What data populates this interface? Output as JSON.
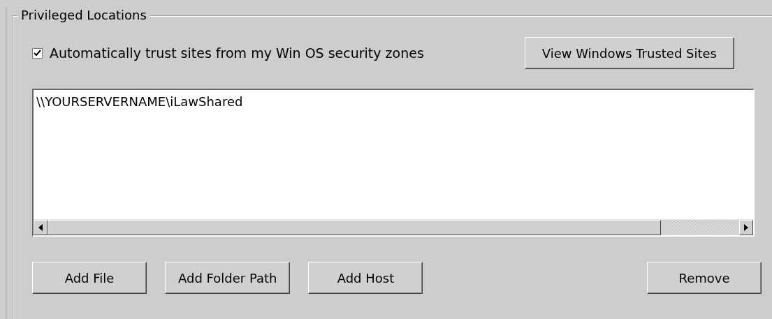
{
  "group": {
    "title": "Privileged Locations"
  },
  "auto_trust": {
    "label": "Automatically trust sites from my Win OS security zones",
    "checked": true
  },
  "view_button": "View Windows Trusted Sites",
  "locations": [
    {
      "path": "\\\\YOURSERVERNAME\\iLawShared",
      "selected": false
    }
  ],
  "buttons": [
    "Add File",
    "Add Folder Path",
    "Add Host",
    "Remove"
  ]
}
